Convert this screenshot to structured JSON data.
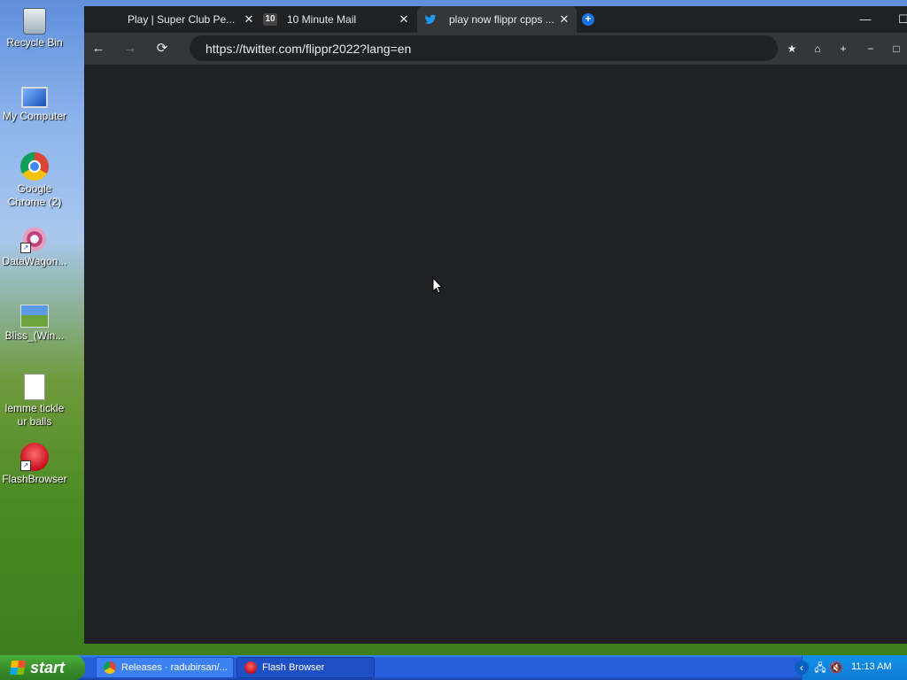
{
  "desktop": {
    "icons": [
      {
        "label": "Recycle Bin",
        "icon": "recycle-bin-icon"
      },
      {
        "label": "My Computer",
        "icon": "computer-icon"
      },
      {
        "label": "Google Chrome (2)",
        "icon": "chrome-icon"
      },
      {
        "label": "DataWagon...",
        "icon": "datawagon-icon"
      },
      {
        "label": "Bliss_(Win...",
        "icon": "image-file-icon"
      },
      {
        "label": "lemme tickle ur balls",
        "icon": "text-file-icon"
      },
      {
        "label": "FlashBrowser",
        "icon": "flashbrowser-icon"
      }
    ]
  },
  "browser": {
    "tabs": [
      {
        "title": "Play | Super Club Pe...",
        "favicon": "none",
        "active": false
      },
      {
        "title": "10 Minute Mail",
        "favicon": "10",
        "active": false
      },
      {
        "title": "play now flippr cpps ...",
        "favicon": "twitter-bird-icon",
        "active": true
      }
    ],
    "new_tab_symbol": "+",
    "address": "https://twitter.com/flippr2022?lang=en",
    "theme": {
      "frame": "#202124",
      "toolbar": "#35363a",
      "text": "#e8eaed"
    }
  },
  "taskbar": {
    "start_label": "start",
    "tasks": [
      {
        "label": "Releases · radubirsan/...",
        "icon": "chrome-icon"
      },
      {
        "label": "Flash Browser",
        "icon": "flashbrowser-icon"
      }
    ],
    "clock": "11:13 AM"
  }
}
